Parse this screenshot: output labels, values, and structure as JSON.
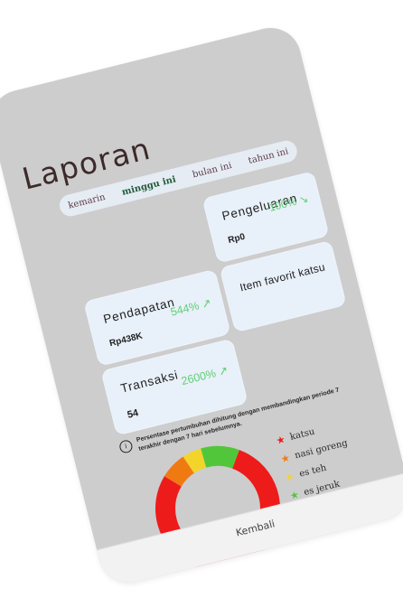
{
  "title": "Laporan",
  "tabs": [
    {
      "label": "kemarin"
    },
    {
      "label": "minggu ini",
      "active": true
    },
    {
      "label": "bulan ini"
    },
    {
      "label": "tahun ini"
    }
  ],
  "cards": {
    "pendapatan": {
      "label": "Pendapatan",
      "value": "Rp438K",
      "change": "544% ↗"
    },
    "pengeluaran": {
      "label": "Pengeluaran",
      "value": "Rp0",
      "change": "-100% ↘"
    },
    "item_favorit": {
      "label": "Item favorit katsu"
    },
    "transaksi": {
      "label": "Transaksi",
      "value": "54",
      "change": "2600% ↗"
    }
  },
  "info": {
    "icon": "info-icon",
    "text": "Persentase pertumbuhan dihitung dengan membandingkan periode 7 terakhir dengan 7 hari sebelumnya."
  },
  "legend": [
    {
      "label": "katsu",
      "color": "#ee1b1b"
    },
    {
      "label": "nasi goreng",
      "color": "#f07a12"
    },
    {
      "label": "es teh",
      "color": "#f3d42a"
    },
    {
      "label": "es jeruk",
      "color": "#52c63a"
    }
  ],
  "chart_data": {
    "type": "pie",
    "categories": [
      "katsu",
      "nasi goreng",
      "es teh",
      "es jeruk"
    ],
    "values": [
      78,
      7,
      5,
      10
    ],
    "colors": [
      "#ee1b1b",
      "#f07a12",
      "#f3d42a",
      "#52c63a"
    ]
  },
  "footer": {
    "back_label": "Kembali"
  }
}
